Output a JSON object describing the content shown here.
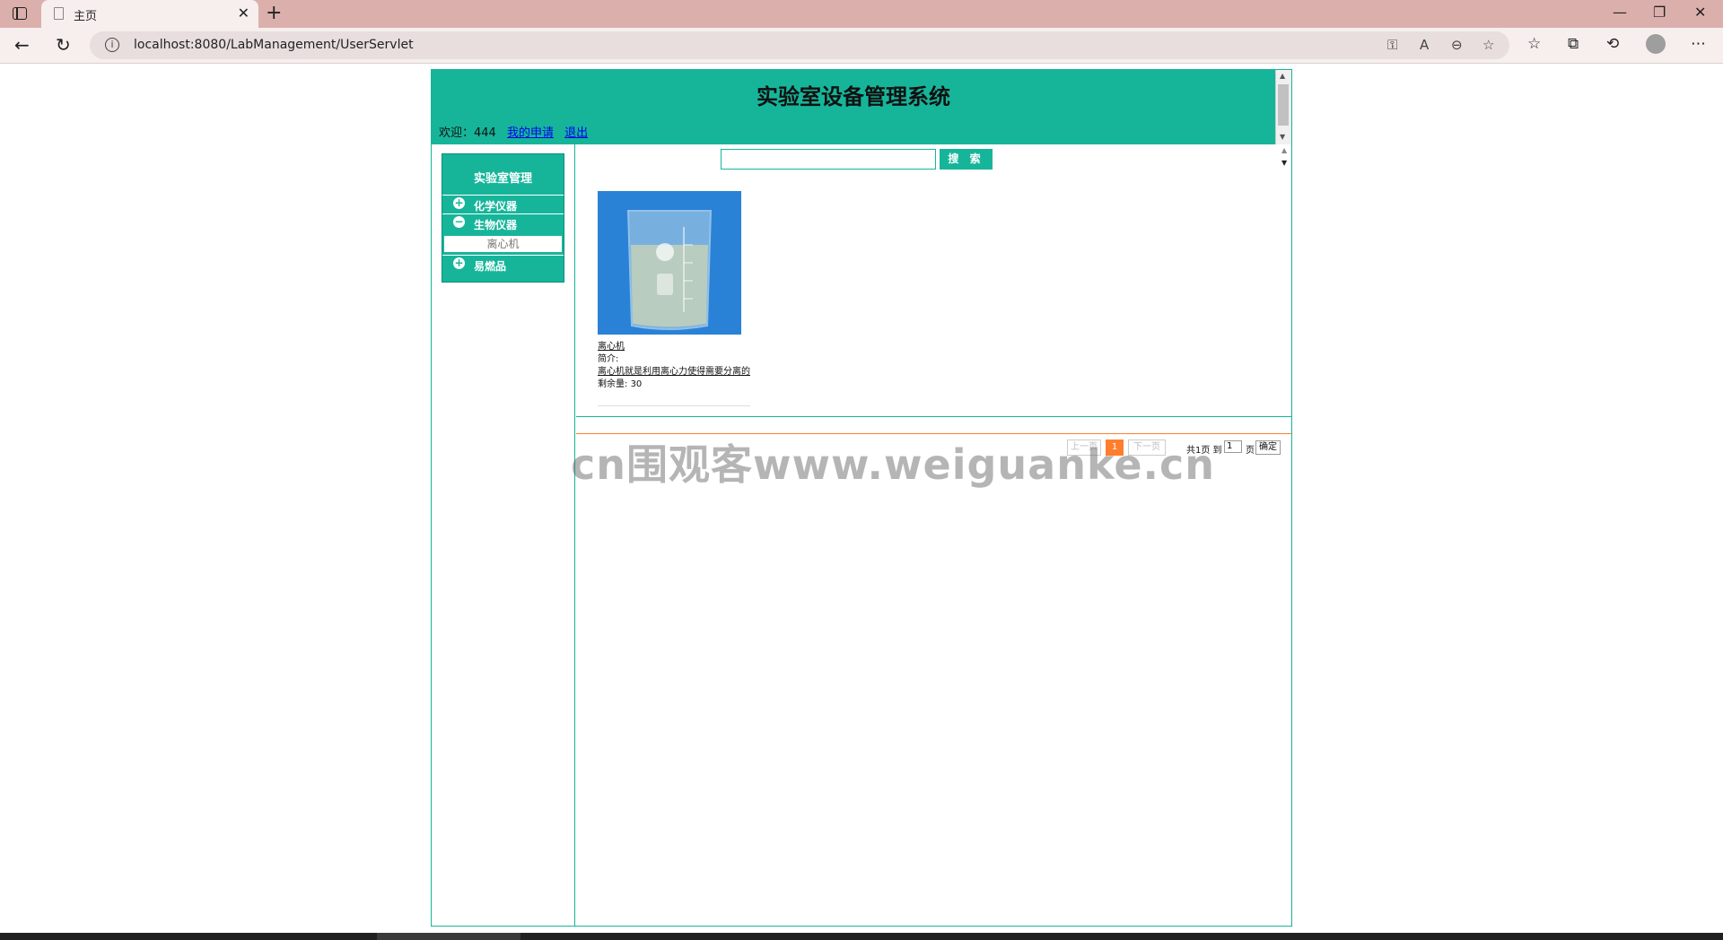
{
  "browser": {
    "tab_title": "主页",
    "url": "localhost:8080/LabManagement/UserServlet",
    "window": {
      "minimize": "—",
      "restore": "❐",
      "close": "✕"
    }
  },
  "page": {
    "title": "实验室设备管理系统",
    "welcome_label": "欢迎：",
    "username": "444",
    "links": {
      "my_applications": "我的申请",
      "logout": "退出"
    }
  },
  "sidebar": {
    "title": "实验室管理",
    "items": [
      {
        "label": "化学仪器",
        "symbol": "+"
      },
      {
        "label": "生物仪器",
        "symbol": "−"
      },
      {
        "label": "易燃品",
        "symbol": "+"
      }
    ],
    "sub_items": [
      {
        "label": "离心机"
      }
    ]
  },
  "search": {
    "button": "搜 索",
    "value": ""
  },
  "products": [
    {
      "name": "离心机",
      "intro_label": "简介:",
      "intro": "离心机就是利用离心力使得需要分离的",
      "remaining_label": "剩余量:",
      "remaining": "30",
      "image": "beaker-500ml-image"
    }
  ],
  "pagination": {
    "prev": "上一页",
    "current": "1",
    "next": "下一页",
    "total_text": "共1页 到",
    "page_input": "1",
    "page_unit": "页",
    "confirm": "确定"
  },
  "watermark": "cn围观客www.weiguanke.cn",
  "colors": {
    "primary": "#16b59a",
    "accent": "#ff7e2e",
    "tab_bar": "#dbb0ac"
  }
}
